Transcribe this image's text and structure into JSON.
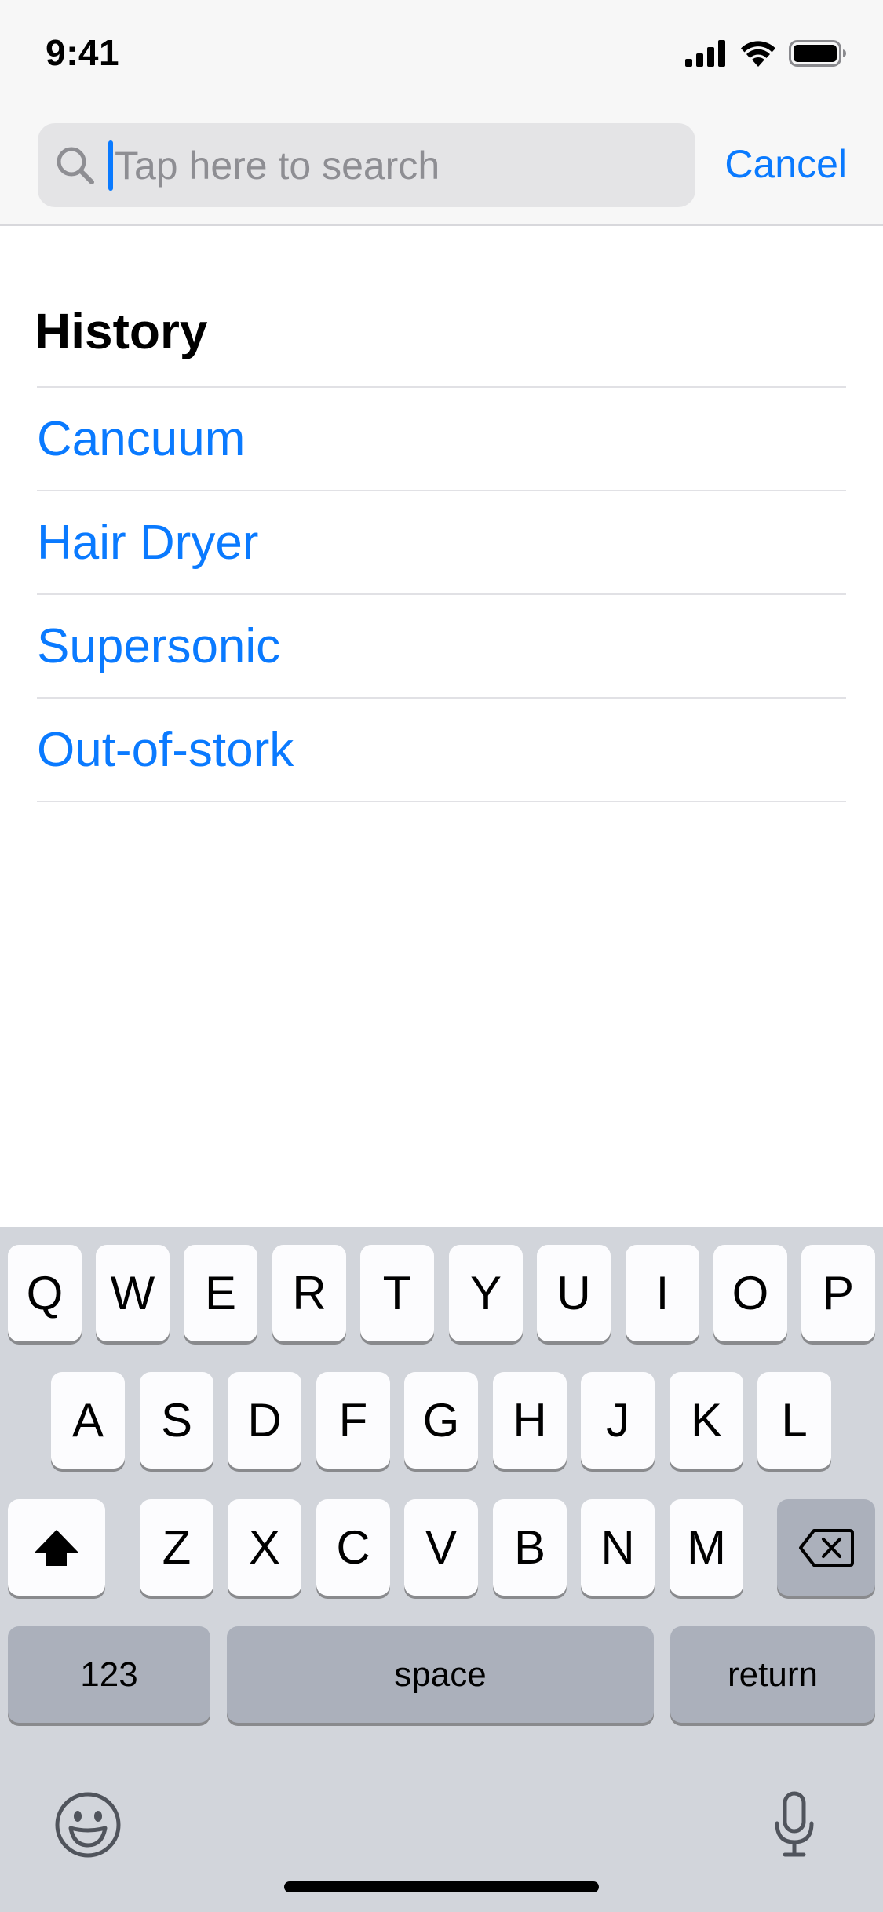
{
  "status_bar": {
    "time": "9:41",
    "icons": [
      "cellular-signal-icon",
      "wifi-icon",
      "battery-icon"
    ]
  },
  "search": {
    "placeholder": "Tap here to search",
    "value": "",
    "cancel_label": "Cancel"
  },
  "history": {
    "title": "History",
    "items": [
      {
        "label": "Cancuum"
      },
      {
        "label": "Hair Dryer"
      },
      {
        "label": "Supersonic"
      },
      {
        "label": "Out-of-stork"
      }
    ]
  },
  "keyboard": {
    "row1": [
      "Q",
      "W",
      "E",
      "R",
      "T",
      "Y",
      "U",
      "I",
      "O",
      "P"
    ],
    "row2": [
      "A",
      "S",
      "D",
      "F",
      "G",
      "H",
      "J",
      "K",
      "L"
    ],
    "row3": [
      "Z",
      "X",
      "C",
      "V",
      "B",
      "N",
      "M"
    ],
    "numbers_label": "123",
    "space_label": "space",
    "return_label": "return",
    "icons": [
      "shift-icon",
      "backspace-icon",
      "emoji-icon",
      "microphone-icon"
    ]
  },
  "colors": {
    "accent": "#0a7aff",
    "keyboard_background": "#d2d5db",
    "key_light": "#fcfcfe",
    "key_dark": "#abb0bb"
  }
}
